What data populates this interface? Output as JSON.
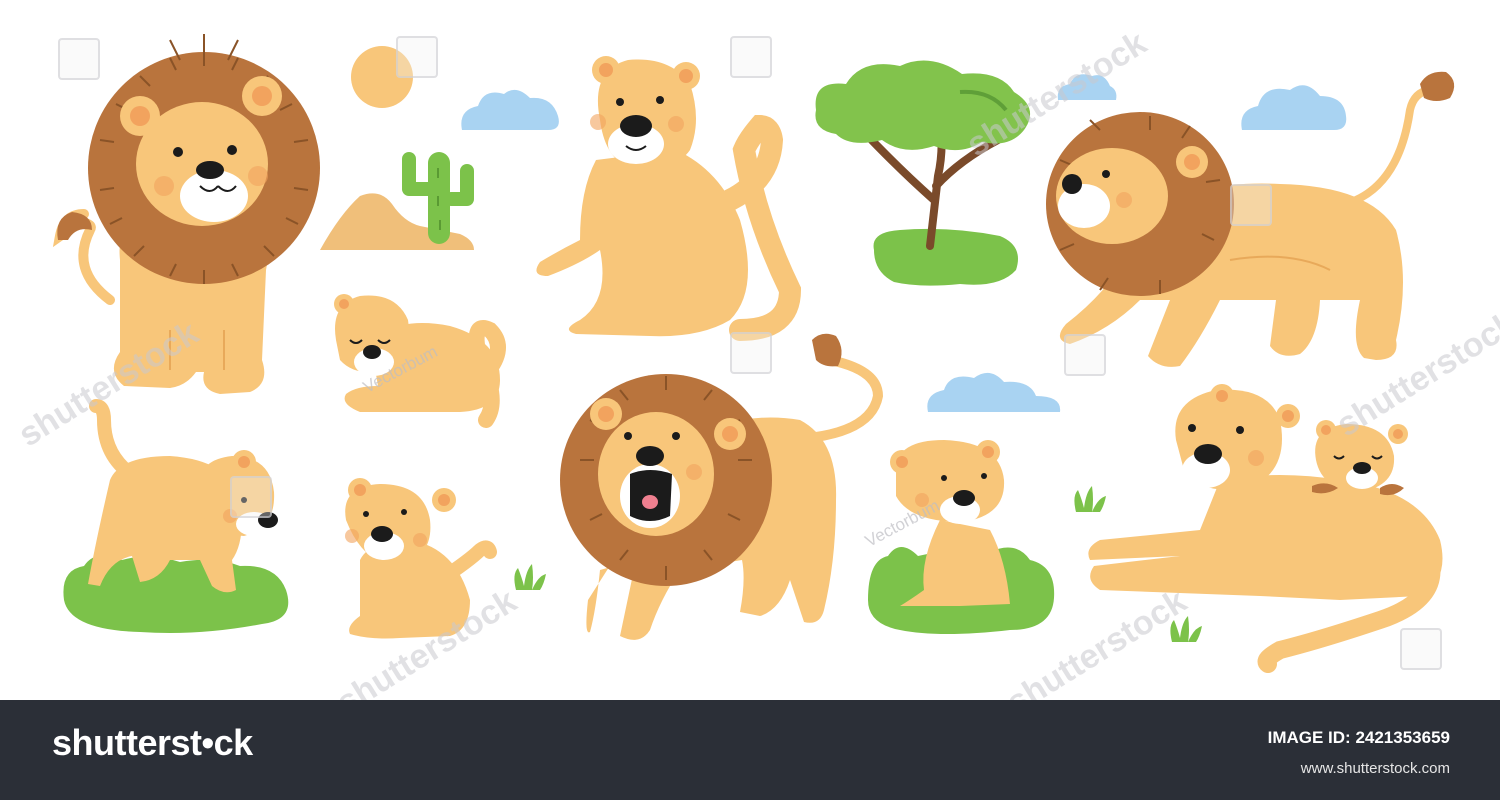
{
  "footer": {
    "logo_text": "shutterst•ck",
    "image_id_text": "IMAGE ID: 2421353659",
    "site_url": "www.shutterstock.com",
    "background_color": "#2b2f37"
  },
  "watermarks": {
    "brand": "shutterstock",
    "author": "Vectorbum"
  },
  "illustration": {
    "colors": {
      "lion_body": "#f8c67a",
      "mane": "#b9743d",
      "mane_line": "#8a5327",
      "cheek": "#f2a35e",
      "nose": "#1b1b1b",
      "grass": "#7cc24a",
      "cloud": "#a9d3f2",
      "sun": "#f8c67a",
      "sand": "#f0bf7a",
      "cactus": "#7cc24a",
      "tree_trunk": "#7a4a2a"
    },
    "items": [
      {
        "name": "sitting-lion"
      },
      {
        "name": "sun"
      },
      {
        "name": "sand-dune"
      },
      {
        "name": "cactus"
      },
      {
        "name": "sitting-lioness"
      },
      {
        "name": "acacia-tree"
      },
      {
        "name": "walking-lion"
      },
      {
        "name": "sleeping-cub"
      },
      {
        "name": "playing-cub"
      },
      {
        "name": "small-cub"
      },
      {
        "name": "roaring-lion"
      },
      {
        "name": "sitting-cub"
      },
      {
        "name": "lying-lioness-with-cub"
      },
      {
        "name": "cloud"
      },
      {
        "name": "grass-tuft"
      }
    ]
  }
}
